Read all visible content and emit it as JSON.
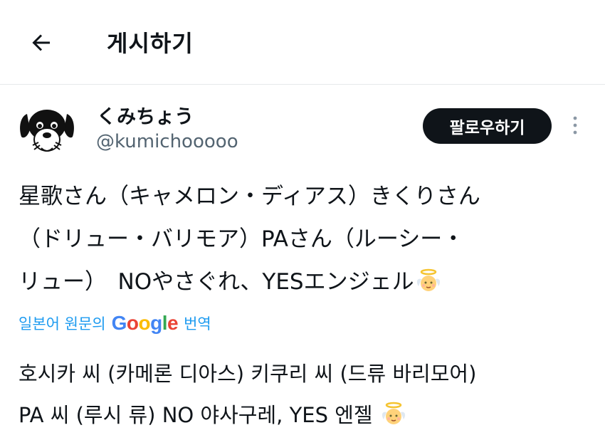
{
  "header": {
    "back_icon": "arrow-left-icon",
    "title": "게시하기"
  },
  "author": {
    "avatar_icon": "dog-avatar",
    "name": "くみちょう",
    "handle": "@kumichooooo",
    "follow_label": "팔로우하기",
    "more_icon": "vertical-dots-icon"
  },
  "post": {
    "line1": "星歌さん（キャメロン・ディアス）きくりさん",
    "line2": "（ドリュー・バリモア）PAさん（ルーシー・",
    "line3": "リュー）　NOやさぐれ、YESエンジェル",
    "emoji": "baby-angel-emoji"
  },
  "translation": {
    "prefix": "일본어 원문의",
    "brand": "Google",
    "suffix": "번역",
    "brand_colors": [
      "#4285F4",
      "#EA4335",
      "#FBBC05",
      "#4285F4",
      "#34A853",
      "#EA4335"
    ],
    "line1": "호시카 씨 (카메론 디아스) 키쿠리 씨 (드류 바리모어)",
    "line2": "PA 씨 (루시 류) NO 야사구레, YES 엔젤"
  },
  "colors": {
    "link": "#1d9bf0",
    "muted": "#536471",
    "text": "#0f1419",
    "divider": "#e6e9eb"
  }
}
